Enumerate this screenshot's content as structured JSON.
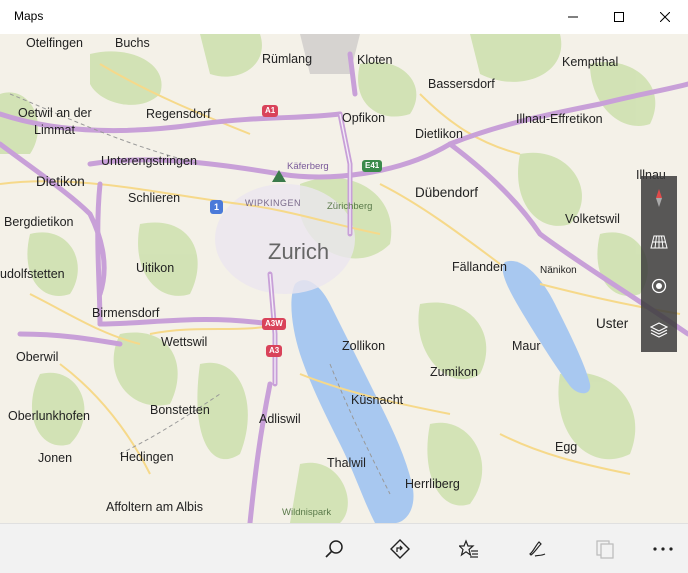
{
  "window": {
    "title": "Maps"
  },
  "map": {
    "city_label": "Zurich",
    "places": [
      {
        "name": "Otelfingen",
        "kind": "town"
      },
      {
        "name": "Buchs",
        "kind": "town"
      },
      {
        "name": "Rümlang",
        "kind": "town"
      },
      {
        "name": "Kloten",
        "kind": "town"
      },
      {
        "name": "Kemptthal",
        "kind": "town"
      },
      {
        "name": "Bassersdorf",
        "kind": "town"
      },
      {
        "name": "Oetwil an der",
        "kind": "town"
      },
      {
        "name": "Limmat",
        "kind": "town"
      },
      {
        "name": "Regensdorf",
        "kind": "town"
      },
      {
        "name": "Opfikon",
        "kind": "town"
      },
      {
        "name": "Dietlikon",
        "kind": "town"
      },
      {
        "name": "Illnau-Effretikon",
        "kind": "town"
      },
      {
        "name": "Unterengstringen",
        "kind": "town"
      },
      {
        "name": "Käferberg",
        "kind": "poi"
      },
      {
        "name": "Illnau",
        "kind": "town"
      },
      {
        "name": "Dietikon",
        "kind": "town"
      },
      {
        "name": "Schlieren",
        "kind": "town"
      },
      {
        "name": "WIPKINGEN",
        "kind": "district"
      },
      {
        "name": "Dübendorf",
        "kind": "town"
      },
      {
        "name": "Zürichberg",
        "kind": "poi"
      },
      {
        "name": "Bergdietikon",
        "kind": "town"
      },
      {
        "name": "Volketswil",
        "kind": "town"
      },
      {
        "name": "Fällanden",
        "kind": "town"
      },
      {
        "name": "Uitikon",
        "kind": "town"
      },
      {
        "name": "Nänikon",
        "kind": "town"
      },
      {
        "name": "udolfstetten",
        "kind": "town"
      },
      {
        "name": "Birmensdorf",
        "kind": "town"
      },
      {
        "name": "Uster",
        "kind": "town"
      },
      {
        "name": "Wettswil",
        "kind": "town"
      },
      {
        "name": "Zollikon",
        "kind": "town"
      },
      {
        "name": "Maur",
        "kind": "town"
      },
      {
        "name": "Oberwil",
        "kind": "town"
      },
      {
        "name": "Zumikon",
        "kind": "town"
      },
      {
        "name": "Küsnacht",
        "kind": "town"
      },
      {
        "name": "Oberlunkhofen",
        "kind": "town"
      },
      {
        "name": "Bonstetten",
        "kind": "town"
      },
      {
        "name": "Adliswil",
        "kind": "town"
      },
      {
        "name": "Egg",
        "kind": "town"
      },
      {
        "name": "Jonen",
        "kind": "town"
      },
      {
        "name": "Hedingen",
        "kind": "town"
      },
      {
        "name": "Thalwil",
        "kind": "town"
      },
      {
        "name": "Herrliberg",
        "kind": "town"
      },
      {
        "name": "Affoltern am Albis",
        "kind": "town"
      },
      {
        "name": "Wildnispark",
        "kind": "poi"
      }
    ],
    "road_shields": [
      {
        "label": "A1",
        "color": "#d9435a"
      },
      {
        "label": "E41",
        "color": "#3a8a4a"
      },
      {
        "label": "1",
        "color": "#4a7ad9"
      },
      {
        "label": "A3W",
        "color": "#d9435a"
      },
      {
        "label": "A3",
        "color": "#d9435a"
      }
    ],
    "colors": {
      "land": "#f4f1e8",
      "forest": "#cfe1b0",
      "water": "#a8c8f0",
      "highway": "#c8a0d8"
    }
  },
  "map_controls": [
    "compass-icon",
    "3d-grid-icon",
    "locate-icon",
    "layers-icon"
  ],
  "bottombar": [
    "search-icon",
    "directions-icon",
    "favorites-icon",
    "ink-icon",
    "tablet-mode-icon",
    "more-icon"
  ]
}
